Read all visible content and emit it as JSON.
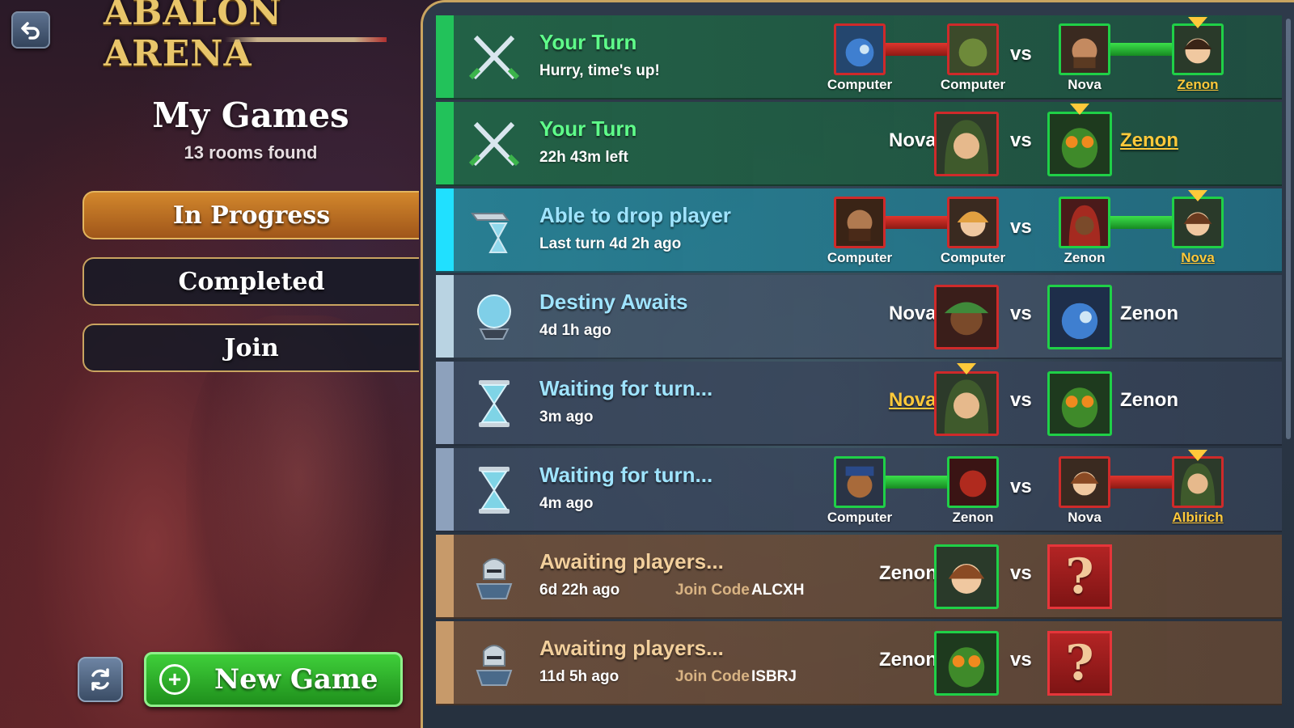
{
  "header": {
    "logo_text": "ABALON ARENA",
    "title": "My Games",
    "subtitle": "13 rooms found"
  },
  "nav": {
    "in_progress": "In Progress",
    "completed": "Completed",
    "join": "Join"
  },
  "new_game_label": "New Game",
  "vs": "vs",
  "join_code_label": "Join Code",
  "rows": [
    {
      "title": "Your Turn",
      "sub": "Hurry, time's up!",
      "players": [
        "Computer",
        "Computer",
        "Nova",
        "Zenon"
      ]
    },
    {
      "title": "Your Turn",
      "sub": "22h 43m left",
      "players": [
        "Nova",
        "Zenon"
      ]
    },
    {
      "title": "Able to drop player",
      "sub": "Last turn 4d 2h ago",
      "players": [
        "Computer",
        "Computer",
        "Zenon",
        "Nova"
      ]
    },
    {
      "title": "Destiny Awaits",
      "sub": "4d 1h ago",
      "players": [
        "Nova",
        "Zenon"
      ]
    },
    {
      "title": "Waiting for turn...",
      "sub": "3m ago",
      "players": [
        "Nova",
        "Zenon"
      ]
    },
    {
      "title": "Waiting for turn...",
      "sub": "4m ago",
      "players": [
        "Computer",
        "Zenon",
        "Nova",
        "Albirich"
      ]
    },
    {
      "title": "Awaiting players...",
      "sub": "6d 22h ago",
      "join_code": "ALCXH",
      "players": [
        "Zenon"
      ]
    },
    {
      "title": "Awaiting players...",
      "sub": "11d 5h ago",
      "join_code": "ISBRJ",
      "players": [
        "Zenon"
      ]
    }
  ],
  "colors": {
    "accent_gold": "#c9a460",
    "nav_active": "#d2872c",
    "new_game_green": "#3fcf3a",
    "your_turn_green": "#5fff8a",
    "highlight_name": "#ffc93a",
    "team_red": "#cf2a2a",
    "team_green": "#1fd047"
  },
  "icons": {
    "back": "back-arrow-icon",
    "refresh": "refresh-icon",
    "plus": "plus-circle-icon",
    "your_turn": "crossed-swords-icon",
    "drop_player": "gauntlet-hourglass-icon",
    "destiny": "crystal-ball-icon",
    "waiting": "hourglass-icon",
    "awaiting": "knight-helmet-icon"
  }
}
